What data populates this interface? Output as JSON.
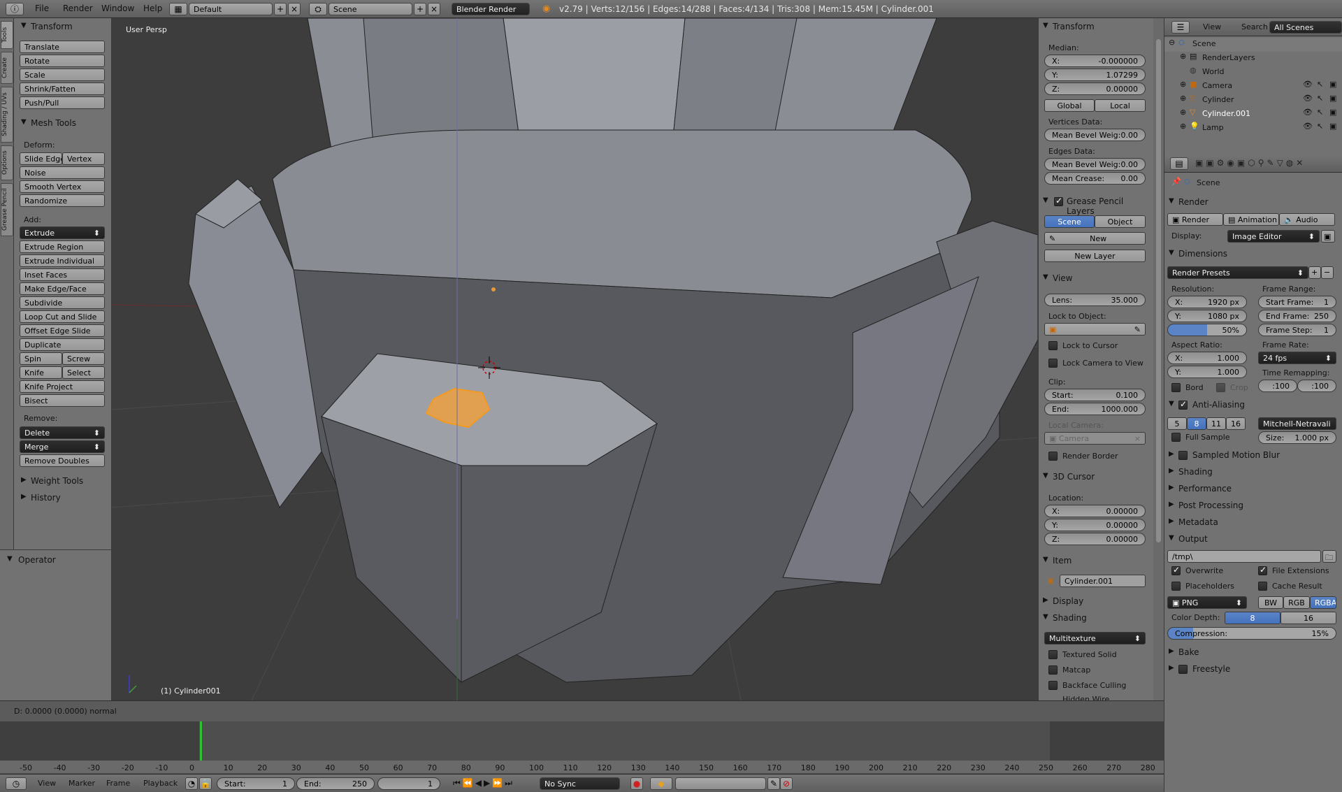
{
  "topbar": {
    "menus": [
      "File",
      "Render",
      "Window",
      "Help"
    ],
    "layout": "Default",
    "scene": "Scene",
    "engine": "Blender Render",
    "stats": "v2.79 | Verts:12/156 | Edges:14/288 | Faces:4/134 | Tris:308 | Mem:15.45M | Cylinder.001"
  },
  "lefttabs": [
    "Tools",
    "Create",
    "Shading / UVs",
    "Options",
    "Grease Pencil"
  ],
  "tools": {
    "transform_title": "Transform",
    "transform": [
      "Translate",
      "Rotate",
      "Scale",
      "Shrink/Fatten",
      "Push/Pull"
    ],
    "mesh_title": "Mesh Tools",
    "deform_label": "Deform:",
    "slide_edge": "Slide Edge",
    "vertex": "Vertex",
    "noise": "Noise",
    "smooth_vertex": "Smooth Vertex",
    "randomize": "Randomize",
    "add_label": "Add:",
    "extrude": "Extrude",
    "add": [
      "Extrude Region",
      "Extrude Individual",
      "Inset Faces",
      "Make Edge/Face",
      "Subdivide",
      "Loop Cut and Slide",
      "Offset Edge Slide",
      "Duplicate"
    ],
    "spin": "Spin",
    "screw": "Screw",
    "knife": "Knife",
    "select": "Select",
    "knife_project": "Knife Project",
    "bisect": "Bisect",
    "remove_label": "Remove:",
    "delete": "Delete",
    "merge": "Merge",
    "remove_doubles": "Remove Doubles",
    "weight_tools": "Weight Tools",
    "history": "History",
    "operator": "Operator"
  },
  "viewport": {
    "view_label": "User Persp",
    "object_label": "(1) Cylinder001",
    "status": "D: 0.0000 (0.0000) normal"
  },
  "npanel": {
    "transform": "Transform",
    "median": "Median:",
    "x_k": "X:",
    "x": "-0.000000",
    "y_k": "Y:",
    "y": "1.07299",
    "z_k": "Z:",
    "z": "0.00000",
    "global": "Global",
    "local": "Local",
    "vertices_data": "Vertices Data:",
    "mean_bevel_v": "Mean Bevel Weig:",
    "mean_bevel_v_val": "0.00",
    "edges_data": "Edges Data:",
    "mean_bevel_e": "Mean Bevel Weig:",
    "mean_bevel_e_val": "0.00",
    "mean_crease": "Mean Crease:",
    "mean_crease_val": "0.00",
    "gp_layers": "Grease Pencil Layers",
    "scene_btn": "Scene",
    "object_btn": "Object",
    "new": "New",
    "new_layer": "New Layer",
    "view": "View",
    "lens_k": "Lens:",
    "lens": "35.000",
    "lock_obj": "Lock to Object:",
    "lock_cursor": "Lock to Cursor",
    "lock_camera": "Lock Camera to View",
    "clip": "Clip:",
    "start_k": "Start:",
    "start": "0.100",
    "end_k": "End:",
    "end": "1000.000",
    "local_camera": "Local Camera:",
    "camera": "Camera",
    "render_border": "Render Border",
    "cursor": "3D Cursor",
    "location": "Location:",
    "cx": "0.00000",
    "cy": "0.00000",
    "cz": "0.00000",
    "item": "Item",
    "item_name": "Cylinder.001",
    "display": "Display",
    "shading": "Shading",
    "multitexture": "Multitexture",
    "textured_solid": "Textured Solid",
    "matcap": "Matcap",
    "backface": "Backface Culling",
    "hidden_wire": "Hidden Wire"
  },
  "outliner": {
    "view": "View",
    "search": "Search",
    "all_scenes": "All Scenes",
    "items": [
      {
        "name": "Scene",
        "indent": 0
      },
      {
        "name": "RenderLayers",
        "indent": 1
      },
      {
        "name": "World",
        "indent": 1
      },
      {
        "name": "Camera",
        "indent": 1
      },
      {
        "name": "Cylinder",
        "indent": 1
      },
      {
        "name": "Cylinder.001",
        "indent": 1
      },
      {
        "name": "Lamp",
        "indent": 1
      }
    ]
  },
  "props": {
    "scene": "Scene",
    "render": "Render",
    "render_btn": "Render",
    "animation_btn": "Animation",
    "audio_btn": "Audio",
    "display_k": "Display:",
    "display": "Image Editor",
    "dimensions": "Dimensions",
    "presets": "Render Presets",
    "resolution": "Resolution:",
    "res_x": "1920 px",
    "res_y": "1080 px",
    "res_pct": "50%",
    "frame_range": "Frame Range:",
    "start_frame": "Start Frame:",
    "start_frame_v": "1",
    "end_frame": "End Frame:",
    "end_frame_v": "250",
    "frame_step": "Frame Step:",
    "frame_step_v": "1",
    "aspect": "Aspect Ratio:",
    "asp_x": "1.000",
    "asp_y": "1.000",
    "frame_rate": "Frame Rate:",
    "fps": "24 fps",
    "bord": "Bord",
    "crop": "Crop",
    "time_remap": "Time Remapping:",
    "old": ":100",
    "new": ":100",
    "aa": "Anti-Aliasing",
    "aa_vals": [
      "5",
      "8",
      "11",
      "16"
    ],
    "filter": "Mitchell-Netravali",
    "full_sample": "Full Sample",
    "size_k": "Size:",
    "size": "1.000 px",
    "sections": [
      "Sampled Motion Blur",
      "Shading",
      "Performance",
      "Post Processing",
      "Metadata"
    ],
    "output": "Output",
    "path": "/tmp\\",
    "overwrite": "Overwrite",
    "file_ext": "File Extensions",
    "placeholders": "Placeholders",
    "cache": "Cache Result",
    "png": "PNG",
    "bw": "BW",
    "rgb": "RGB",
    "rgba": "RGBA",
    "depth_k": "Color Depth:",
    "d8": "8",
    "d16": "16",
    "compression": "Compression:",
    "compression_v": "15%",
    "bake": "Bake",
    "freestyle": "Freestyle"
  },
  "timeline": {
    "ticks": [
      "-50",
      "-40",
      "-30",
      "-20",
      "-10",
      "0",
      "10",
      "20",
      "30",
      "40",
      "50",
      "60",
      "70",
      "80",
      "90",
      "100",
      "110",
      "120",
      "130",
      "140",
      "150",
      "160",
      "170",
      "180",
      "190",
      "200",
      "210",
      "220",
      "230",
      "240",
      "250",
      "260",
      "270",
      "280"
    ],
    "view": "View",
    "marker": "Marker",
    "frame": "Frame",
    "playback": "Playback",
    "start_k": "Start:",
    "start": "1",
    "end_k": "End:",
    "end": "250",
    "current": "1",
    "sync": "No Sync"
  }
}
